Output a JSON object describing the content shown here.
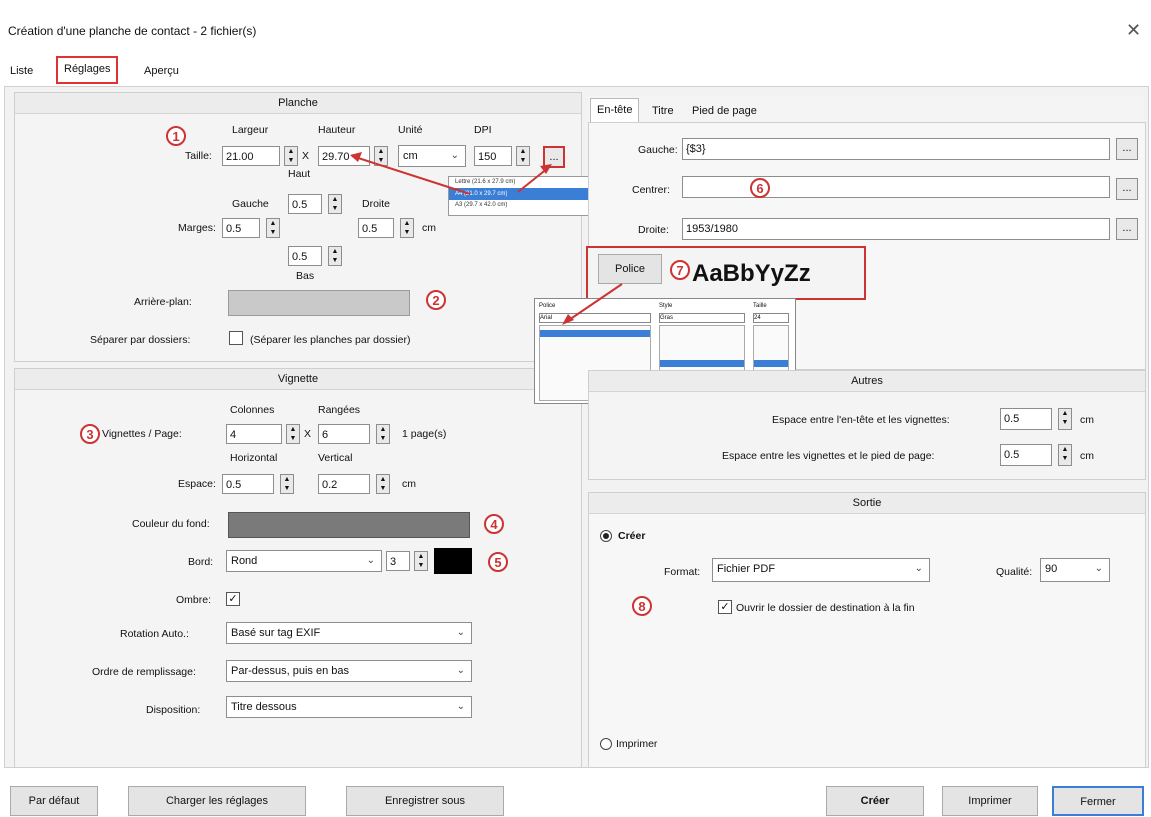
{
  "window": {
    "title": "Création d'une planche de contact - 2 fichier(s)",
    "close_glyph": "✕"
  },
  "tabs": [
    "Liste",
    "Réglages",
    "Aperçu"
  ],
  "planche": {
    "header": "Planche",
    "col_largeur": "Largeur",
    "col_hauteur": "Hauteur",
    "col_unite": "Unité",
    "col_dpi": "DPI",
    "taille_label": "Taille:",
    "largeur": "21.00",
    "x": "X",
    "hauteur": "29.70",
    "unite": "cm",
    "dpi": "150",
    "ellipsis": "...",
    "haut_label": "Haut",
    "haut": "0.5",
    "gauche_label": "Gauche",
    "droite_label": "Droite",
    "marges_label": "Marges:",
    "gauche": "0.5",
    "droite": "0.5",
    "marges_unit": "cm",
    "bas": "0.5",
    "bas_label": "Bas",
    "arriere_plan_label": "Arrière-plan:",
    "separer_label": "Séparer par dossiers:",
    "separer_text": "(Séparer les planches par dossier)",
    "paper_popup_items": [
      "Lettre (21.6 x 27.9 cm)",
      "A4 (21.0 x 29.7 cm)",
      "A3 (29.7 x 42.0 cm)"
    ]
  },
  "vignette": {
    "header": "Vignette",
    "col_colonnes": "Colonnes",
    "col_rangees": "Rangées",
    "vignettes_label": "Vignettes / Page:",
    "colonnes": "4",
    "x": "X",
    "rangees": "6",
    "pages": "1 page(s)",
    "col_horizontal": "Horizontal",
    "col_vertical": "Vertical",
    "espace_label": "Espace:",
    "horizontal": "0.5",
    "vertical": "0.2",
    "espace_unit": "cm",
    "couleur_label": "Couleur du fond:",
    "bord_label": "Bord:",
    "bord": "Rond",
    "bord_size": "3",
    "ombre_label": "Ombre:",
    "rotation_label": "Rotation Auto.:",
    "rotation": "Basé sur tag EXIF",
    "ordre_label": "Ordre de remplissage:",
    "ordre": "Par-dessus, puis en bas",
    "disposition_label": "Disposition:",
    "disposition": "Titre dessous"
  },
  "entete": {
    "tabs": [
      "En-tête",
      "Titre",
      "Pied de page"
    ],
    "gauche_label": "Gauche:",
    "gauche": "{$3}",
    "centrer_label": "Centrer:",
    "centrer": "",
    "droite_label": "Droite:",
    "droite": "1953/1980",
    "police_button": "Police",
    "font_preview": "AaBbYyZz",
    "font_popup": {
      "col_police": "Police",
      "col_style": "Style",
      "col_taille": "Taille",
      "police_value": "Arial",
      "style_value": "Gras",
      "taille_value": "24"
    }
  },
  "autres": {
    "header": "Autres",
    "espace1_label": "Espace entre l'en-tête et les vignettes:",
    "espace1": "0.5",
    "espace1_unit": "cm",
    "espace2_label": "Espace entre les vignettes et le pied de page:",
    "espace2": "0.5",
    "espace2_unit": "cm"
  },
  "sortie": {
    "header": "Sortie",
    "creer_radio": "Créer",
    "format_label": "Format:",
    "format": "Fichier PDF",
    "qualite_label": "Qualité:",
    "qualite": "90",
    "ouvrir_label": "Ouvrir le dossier de destination à la fin",
    "imprimer_radio": "Imprimer"
  },
  "callouts": [
    "1",
    "2",
    "3",
    "4",
    "5",
    "6",
    "7",
    "8"
  ],
  "buttons": {
    "par_defaut": "Par défaut",
    "charger": "Charger les réglages",
    "enregistrer": "Enregistrer sous",
    "creer": "Créer",
    "imprimer": "Imprimer",
    "fermer": "Fermer"
  },
  "colors": {
    "accent_red": "#cc3333",
    "background_swatch": "#c9c9c9",
    "color_swatch": "#7a7a7a",
    "border_swatch": "#000000",
    "popup_highlight": "#3a7fd5"
  },
  "icons": {
    "checkmark": "✓",
    "chevron": "⌄",
    "spin_up": "▲",
    "spin_down": "▼"
  }
}
